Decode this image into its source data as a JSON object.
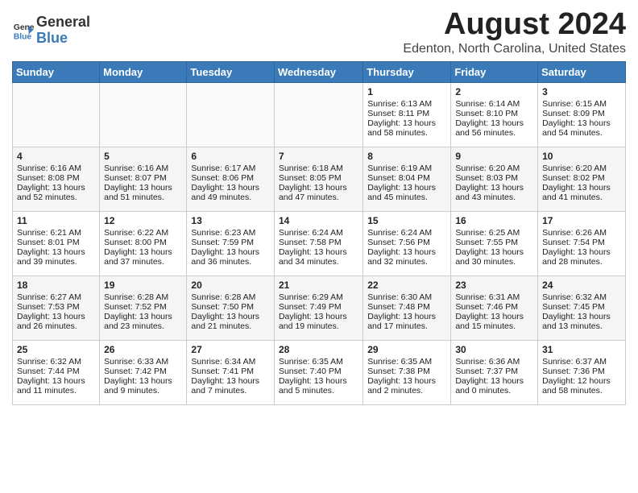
{
  "header": {
    "logo_line1": "General",
    "logo_line2": "Blue",
    "month_year": "August 2024",
    "location": "Edenton, North Carolina, United States"
  },
  "weekdays": [
    "Sunday",
    "Monday",
    "Tuesday",
    "Wednesday",
    "Thursday",
    "Friday",
    "Saturday"
  ],
  "weeks": [
    [
      {
        "day": "",
        "sunrise": "",
        "sunset": "",
        "daylight": ""
      },
      {
        "day": "",
        "sunrise": "",
        "sunset": "",
        "daylight": ""
      },
      {
        "day": "",
        "sunrise": "",
        "sunset": "",
        "daylight": ""
      },
      {
        "day": "",
        "sunrise": "",
        "sunset": "",
        "daylight": ""
      },
      {
        "day": "1",
        "sunrise": "6:13 AM",
        "sunset": "8:11 PM",
        "daylight": "13 hours and 58 minutes."
      },
      {
        "day": "2",
        "sunrise": "6:14 AM",
        "sunset": "8:10 PM",
        "daylight": "13 hours and 56 minutes."
      },
      {
        "day": "3",
        "sunrise": "6:15 AM",
        "sunset": "8:09 PM",
        "daylight": "13 hours and 54 minutes."
      }
    ],
    [
      {
        "day": "4",
        "sunrise": "6:16 AM",
        "sunset": "8:08 PM",
        "daylight": "13 hours and 52 minutes."
      },
      {
        "day": "5",
        "sunrise": "6:16 AM",
        "sunset": "8:07 PM",
        "daylight": "13 hours and 51 minutes."
      },
      {
        "day": "6",
        "sunrise": "6:17 AM",
        "sunset": "8:06 PM",
        "daylight": "13 hours and 49 minutes."
      },
      {
        "day": "7",
        "sunrise": "6:18 AM",
        "sunset": "8:05 PM",
        "daylight": "13 hours and 47 minutes."
      },
      {
        "day": "8",
        "sunrise": "6:19 AM",
        "sunset": "8:04 PM",
        "daylight": "13 hours and 45 minutes."
      },
      {
        "day": "9",
        "sunrise": "6:20 AM",
        "sunset": "8:03 PM",
        "daylight": "13 hours and 43 minutes."
      },
      {
        "day": "10",
        "sunrise": "6:20 AM",
        "sunset": "8:02 PM",
        "daylight": "13 hours and 41 minutes."
      }
    ],
    [
      {
        "day": "11",
        "sunrise": "6:21 AM",
        "sunset": "8:01 PM",
        "daylight": "13 hours and 39 minutes."
      },
      {
        "day": "12",
        "sunrise": "6:22 AM",
        "sunset": "8:00 PM",
        "daylight": "13 hours and 37 minutes."
      },
      {
        "day": "13",
        "sunrise": "6:23 AM",
        "sunset": "7:59 PM",
        "daylight": "13 hours and 36 minutes."
      },
      {
        "day": "14",
        "sunrise": "6:24 AM",
        "sunset": "7:58 PM",
        "daylight": "13 hours and 34 minutes."
      },
      {
        "day": "15",
        "sunrise": "6:24 AM",
        "sunset": "7:56 PM",
        "daylight": "13 hours and 32 minutes."
      },
      {
        "day": "16",
        "sunrise": "6:25 AM",
        "sunset": "7:55 PM",
        "daylight": "13 hours and 30 minutes."
      },
      {
        "day": "17",
        "sunrise": "6:26 AM",
        "sunset": "7:54 PM",
        "daylight": "13 hours and 28 minutes."
      }
    ],
    [
      {
        "day": "18",
        "sunrise": "6:27 AM",
        "sunset": "7:53 PM",
        "daylight": "13 hours and 26 minutes."
      },
      {
        "day": "19",
        "sunrise": "6:28 AM",
        "sunset": "7:52 PM",
        "daylight": "13 hours and 23 minutes."
      },
      {
        "day": "20",
        "sunrise": "6:28 AM",
        "sunset": "7:50 PM",
        "daylight": "13 hours and 21 minutes."
      },
      {
        "day": "21",
        "sunrise": "6:29 AM",
        "sunset": "7:49 PM",
        "daylight": "13 hours and 19 minutes."
      },
      {
        "day": "22",
        "sunrise": "6:30 AM",
        "sunset": "7:48 PM",
        "daylight": "13 hours and 17 minutes."
      },
      {
        "day": "23",
        "sunrise": "6:31 AM",
        "sunset": "7:46 PM",
        "daylight": "13 hours and 15 minutes."
      },
      {
        "day": "24",
        "sunrise": "6:32 AM",
        "sunset": "7:45 PM",
        "daylight": "13 hours and 13 minutes."
      }
    ],
    [
      {
        "day": "25",
        "sunrise": "6:32 AM",
        "sunset": "7:44 PM",
        "daylight": "13 hours and 11 minutes."
      },
      {
        "day": "26",
        "sunrise": "6:33 AM",
        "sunset": "7:42 PM",
        "daylight": "13 hours and 9 minutes."
      },
      {
        "day": "27",
        "sunrise": "6:34 AM",
        "sunset": "7:41 PM",
        "daylight": "13 hours and 7 minutes."
      },
      {
        "day": "28",
        "sunrise": "6:35 AM",
        "sunset": "7:40 PM",
        "daylight": "13 hours and 5 minutes."
      },
      {
        "day": "29",
        "sunrise": "6:35 AM",
        "sunset": "7:38 PM",
        "daylight": "13 hours and 2 minutes."
      },
      {
        "day": "30",
        "sunrise": "6:36 AM",
        "sunset": "7:37 PM",
        "daylight": "13 hours and 0 minutes."
      },
      {
        "day": "31",
        "sunrise": "6:37 AM",
        "sunset": "7:36 PM",
        "daylight": "12 hours and 58 minutes."
      }
    ]
  ]
}
